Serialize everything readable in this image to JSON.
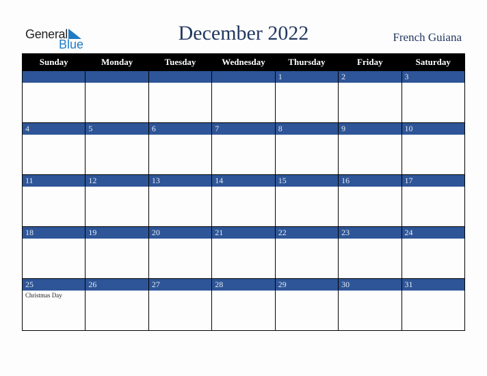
{
  "logo": {
    "line1": "General",
    "line2": "Blue"
  },
  "header": {
    "title": "December 2022",
    "country": "French Guiana"
  },
  "colors": {
    "header_bg": "#000000",
    "day_bar": "#2e5597",
    "title": "#22385f",
    "logo_blue": "#1f7ac4"
  },
  "weekdays": [
    "Sunday",
    "Monday",
    "Tuesday",
    "Wednesday",
    "Thursday",
    "Friday",
    "Saturday"
  ],
  "weeks": [
    [
      {
        "day": ""
      },
      {
        "day": ""
      },
      {
        "day": ""
      },
      {
        "day": ""
      },
      {
        "day": "1"
      },
      {
        "day": "2"
      },
      {
        "day": "3"
      }
    ],
    [
      {
        "day": "4"
      },
      {
        "day": "5"
      },
      {
        "day": "6"
      },
      {
        "day": "7"
      },
      {
        "day": "8"
      },
      {
        "day": "9"
      },
      {
        "day": "10"
      }
    ],
    [
      {
        "day": "11"
      },
      {
        "day": "12"
      },
      {
        "day": "13"
      },
      {
        "day": "14"
      },
      {
        "day": "15"
      },
      {
        "day": "16"
      },
      {
        "day": "17"
      }
    ],
    [
      {
        "day": "18"
      },
      {
        "day": "19"
      },
      {
        "day": "20"
      },
      {
        "day": "21"
      },
      {
        "day": "22"
      },
      {
        "day": "23"
      },
      {
        "day": "24"
      }
    ],
    [
      {
        "day": "25",
        "event": "Christmas Day"
      },
      {
        "day": "26"
      },
      {
        "day": "27"
      },
      {
        "day": "28"
      },
      {
        "day": "29"
      },
      {
        "day": "30"
      },
      {
        "day": "31"
      }
    ]
  ]
}
